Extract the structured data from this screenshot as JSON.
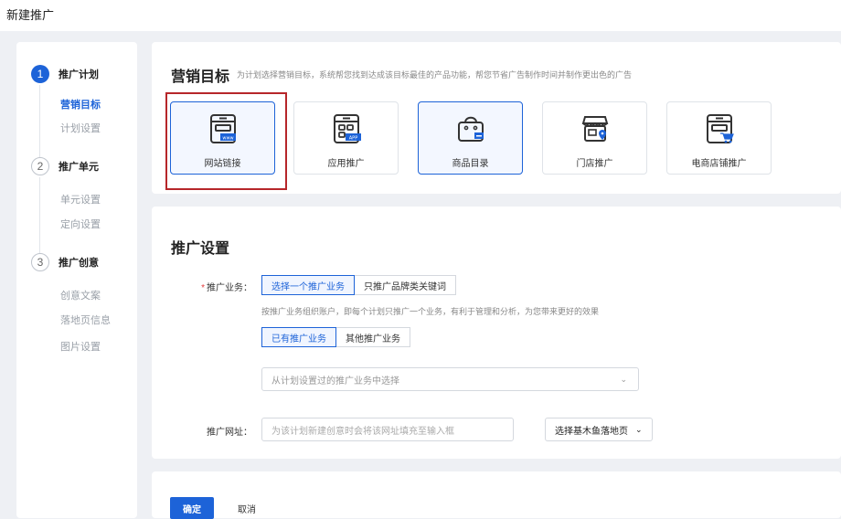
{
  "page": {
    "title": "新建推广"
  },
  "sidebar": {
    "steps": [
      {
        "num": "1",
        "label": "推广计划",
        "subs": [
          "营销目标",
          "计划设置"
        ]
      },
      {
        "num": "2",
        "label": "推广单元",
        "subs": [
          "单元设置",
          "定向设置"
        ]
      },
      {
        "num": "3",
        "label": "推广创意",
        "subs": [
          "创意文案",
          "落地页信息",
          "图片设置"
        ]
      }
    ]
  },
  "goal": {
    "title": "营销目标",
    "desc": "为计划选择营销目标，系统帮您找到达成该目标最佳的产品功能，帮您节省广告制作时间并制作更出色的广告",
    "options": [
      {
        "label": "网站链接",
        "icon": "website-icon"
      },
      {
        "label": "应用推广",
        "icon": "app-icon"
      },
      {
        "label": "商品目录",
        "icon": "shopping-bag-icon"
      },
      {
        "label": "门店推广",
        "icon": "store-icon"
      },
      {
        "label": "电商店铺推广",
        "icon": "ecommerce-store-icon"
      }
    ]
  },
  "settings": {
    "title": "推广设置",
    "business": {
      "label": "推广业务",
      "required": "*",
      "colon": "：",
      "tabs": [
        "选择一个推广业务",
        "只推广品牌类关键词"
      ],
      "hint": "按推广业务组织账户，即每个计划只推广一个业务，有利于管理和分析，为您带来更好的效果",
      "subtabs": [
        "已有推广业务",
        "其他推广业务"
      ],
      "select_placeholder": "从计划设置过的推广业务中选择"
    },
    "url": {
      "label": "推广网址",
      "colon": "：",
      "placeholder": "为该计划新建创意时会将该网址填充至输入框",
      "button": "选择基木鱼落地页"
    }
  },
  "footer": {
    "ok": "确定",
    "cancel": "取消"
  },
  "colors": {
    "primary": "#1d63d8",
    "highlight_frame": "#b6262a"
  }
}
